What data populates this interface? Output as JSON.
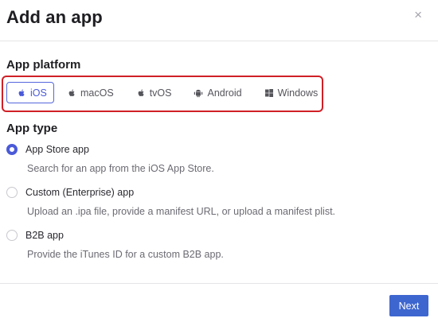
{
  "dialog": {
    "title": "Add an app",
    "close_glyph": "×"
  },
  "platform_section": {
    "title": "App platform",
    "options": [
      {
        "label": "iOS",
        "icon": "apple-icon",
        "selected": true
      },
      {
        "label": "macOS",
        "icon": "apple-icon",
        "selected": false
      },
      {
        "label": "tvOS",
        "icon": "apple-icon",
        "selected": false
      },
      {
        "label": "Android",
        "icon": "android-icon",
        "selected": false
      },
      {
        "label": "Windows",
        "icon": "windows-icon",
        "selected": false
      }
    ]
  },
  "type_section": {
    "title": "App type",
    "options": [
      {
        "label": "App Store app",
        "description": "Search for an app from the iOS App Store.",
        "checked": true
      },
      {
        "label": "Custom (Enterprise) app",
        "description": "Upload an .ipa file, provide a manifest URL, or upload a manifest plist.",
        "checked": false
      },
      {
        "label": "B2B app",
        "description": "Provide the iTunes ID for a custom B2B app.",
        "checked": false
      }
    ]
  },
  "footer": {
    "next_label": "Next"
  },
  "colors": {
    "accent": "#4a5ad8",
    "primary_button": "#3d66cf",
    "highlight_border": "#d01f26"
  }
}
